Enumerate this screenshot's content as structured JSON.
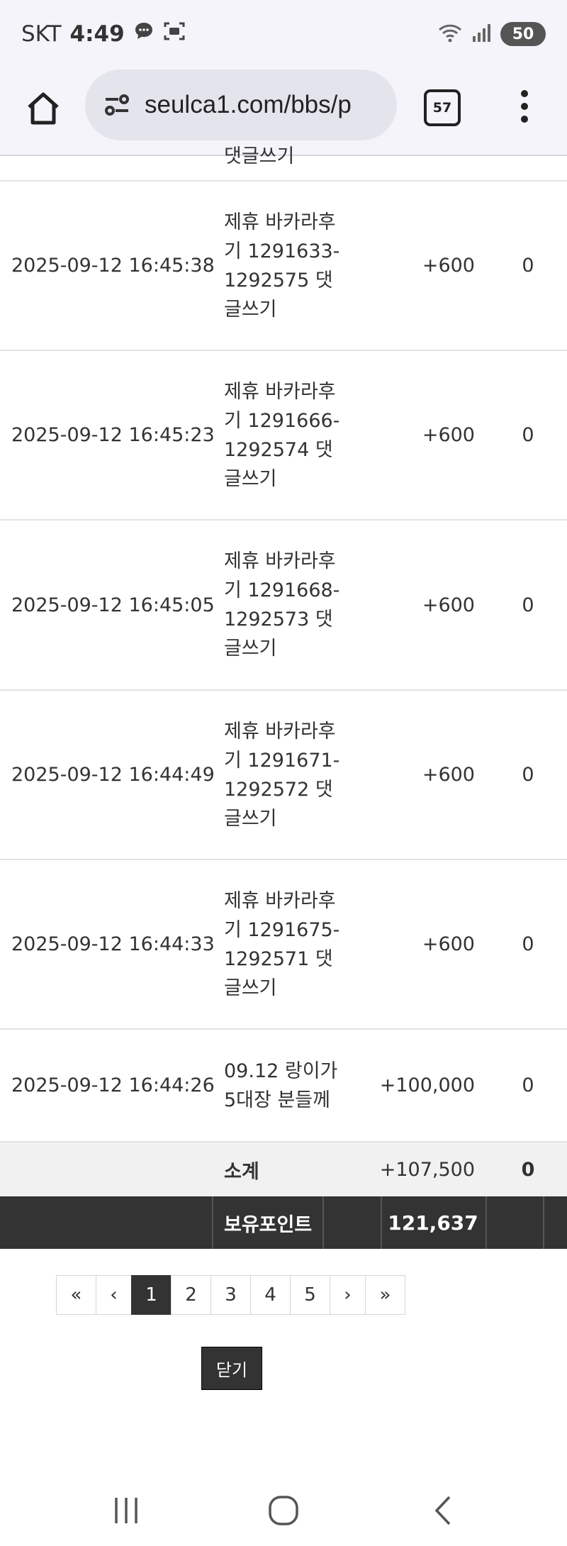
{
  "status_bar": {
    "carrier": "SKT",
    "time": "4:49",
    "battery": "50",
    "icons": [
      "chat-icon",
      "screenshot-icon",
      "wifi-icon",
      "signal-icon"
    ]
  },
  "browser": {
    "url": "seulca1.com/bbs/p",
    "tab_count": "57"
  },
  "table": {
    "partial_row_text": "댓글쓰기",
    "rows": [
      {
        "date": "2025-09-12 16:45:38",
        "desc": "제휴 바카라후기 1291633-1292575 댓글쓰기",
        "point": "+600",
        "used": "0"
      },
      {
        "date": "2025-09-12 16:45:23",
        "desc": "제휴 바카라후기 1291666-1292574 댓글쓰기",
        "point": "+600",
        "used": "0"
      },
      {
        "date": "2025-09-12 16:45:05",
        "desc": "제휴 바카라후기 1291668-1292573 댓글쓰기",
        "point": "+600",
        "used": "0"
      },
      {
        "date": "2025-09-12 16:44:49",
        "desc": "제휴 바카라후기 1291671-1292572 댓글쓰기",
        "point": "+600",
        "used": "0"
      },
      {
        "date": "2025-09-12 16:44:33",
        "desc": "제휴 바카라후기 1291675-1292571 댓글쓰기",
        "point": "+600",
        "used": "0"
      },
      {
        "date": "2025-09-12 16:44:26",
        "desc": "09.12 랑이가 5대장 분들께",
        "point": "+100,000",
        "used": "0"
      }
    ],
    "subtotal": {
      "label": "소계",
      "point": "+107,500",
      "used": "0"
    },
    "holding": {
      "label": "보유포인트",
      "value": "121,637"
    }
  },
  "pagination": {
    "first": "«",
    "prev": "‹",
    "pages": [
      "1",
      "2",
      "3",
      "4",
      "5"
    ],
    "current": "1",
    "next": "›",
    "last": "»"
  },
  "close_button": "닫기"
}
